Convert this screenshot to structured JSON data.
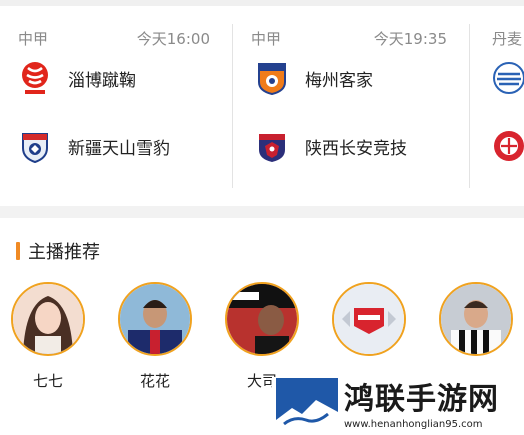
{
  "matches": [
    {
      "league": "中甲",
      "kickoff": "今天16:00",
      "home": {
        "name": "淄博蹴鞠",
        "logo": "zibo-cuju-crest-icon"
      },
      "away": {
        "name": "新疆天山雪豹",
        "logo": "xinjiang-tianshan-crest-icon"
      }
    },
    {
      "league": "中甲",
      "kickoff": "今天19:35",
      "home": {
        "name": "梅州客家",
        "logo": "meizhou-hakka-crest-icon"
      },
      "away": {
        "name": "陕西长安竞技",
        "logo": "shaanxi-changan-crest-icon"
      }
    },
    {
      "league": "丹麦",
      "kickoff": "",
      "home": {
        "name": "",
        "logo": "danish-club-blue-crest-icon"
      },
      "away": {
        "name": "",
        "logo": "danish-club-red-crest-icon"
      }
    }
  ],
  "section": {
    "title": "主播推荐"
  },
  "anchors": [
    {
      "name": "七七"
    },
    {
      "name": "花花"
    },
    {
      "name": "大司"
    },
    {
      "name": ""
    },
    {
      "name": ""
    }
  ],
  "watermark": {
    "title": "鸿联手游网",
    "url": "www.henanhonglian95.com"
  },
  "colors": {
    "accent": "#f08a24",
    "avatar_ring": "#f0a21f",
    "text_muted": "#8a8a8a"
  }
}
